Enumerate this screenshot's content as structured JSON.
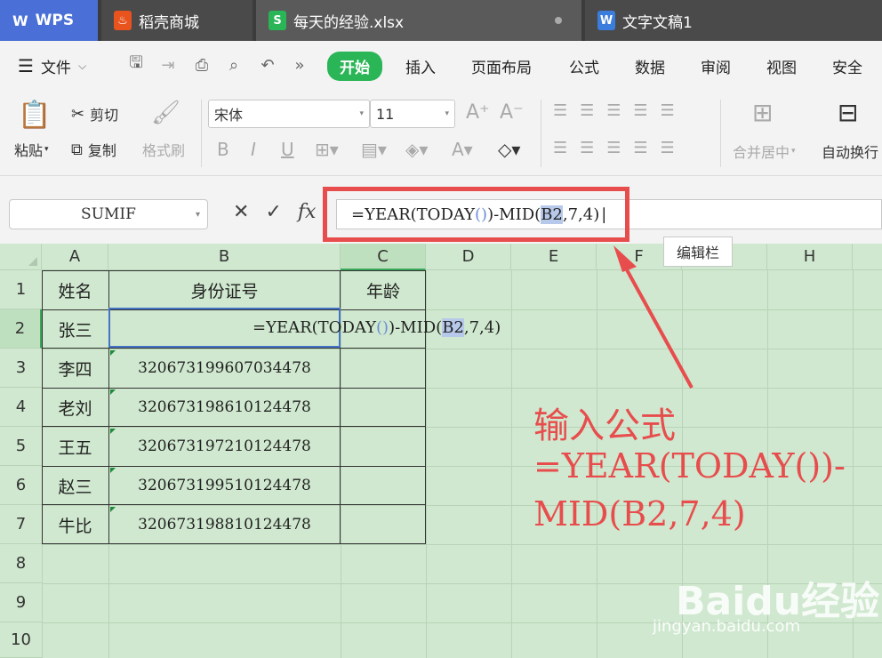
{
  "tabs": {
    "wps_label": "WPS",
    "store_label": "稻壳商城",
    "xlsx_label": "每天的经验.xlsx",
    "doc_label": "文字文稿1"
  },
  "menu": {
    "file": "文件",
    "start": "开始",
    "insert": "插入",
    "page_layout": "页面布局",
    "formula": "公式",
    "data": "数据",
    "review": "审阅",
    "view": "视图",
    "security": "安全"
  },
  "ribbon": {
    "paste": "粘贴",
    "cut": "剪切",
    "copy": "复制",
    "format_painter": "格式刷",
    "font_name": "宋体",
    "font_size": "11",
    "merge_center": "合并居中",
    "wrap_text": "自动换行"
  },
  "formula_bar": {
    "name_box": "SUMIF",
    "f1": "=YEAR(TODAY",
    "f2": "()",
    "f3": ")-MID(",
    "f4": "B2",
    "f5": ",7,4)",
    "tooltip": "编辑栏"
  },
  "columns": [
    "A",
    "B",
    "C",
    "D",
    "E",
    "F",
    "H"
  ],
  "rows": [
    "1",
    "2",
    "3",
    "4",
    "5",
    "6",
    "7",
    "8",
    "9",
    "10"
  ],
  "table": {
    "header": {
      "name": "姓名",
      "id": "身份证号",
      "age": "年龄"
    },
    "r2_name": "张三",
    "r3": {
      "name": "李四",
      "id": "320673199607034478"
    },
    "r4": {
      "name": "老刘",
      "id": "320673198610124478"
    },
    "r5": {
      "name": "王五",
      "id": "320673197210124478"
    },
    "r6": {
      "name": "赵三",
      "id": "320673199510124478"
    },
    "r7": {
      "name": "牛比",
      "id": "320673198810124478"
    }
  },
  "annotation": {
    "line1": "输入公式",
    "line2": "=YEAR(TODAY())-",
    "line3": "MID(B2,7,4)"
  },
  "watermark": {
    "brand": "Baidu经验",
    "url": "jingyan.baidu.com"
  },
  "colors": {
    "accent_green": "#2ab557",
    "annotation_red": "#e84d4d",
    "sheet_bg": "#cfe8cf",
    "selection_blue": "#4472c4"
  }
}
